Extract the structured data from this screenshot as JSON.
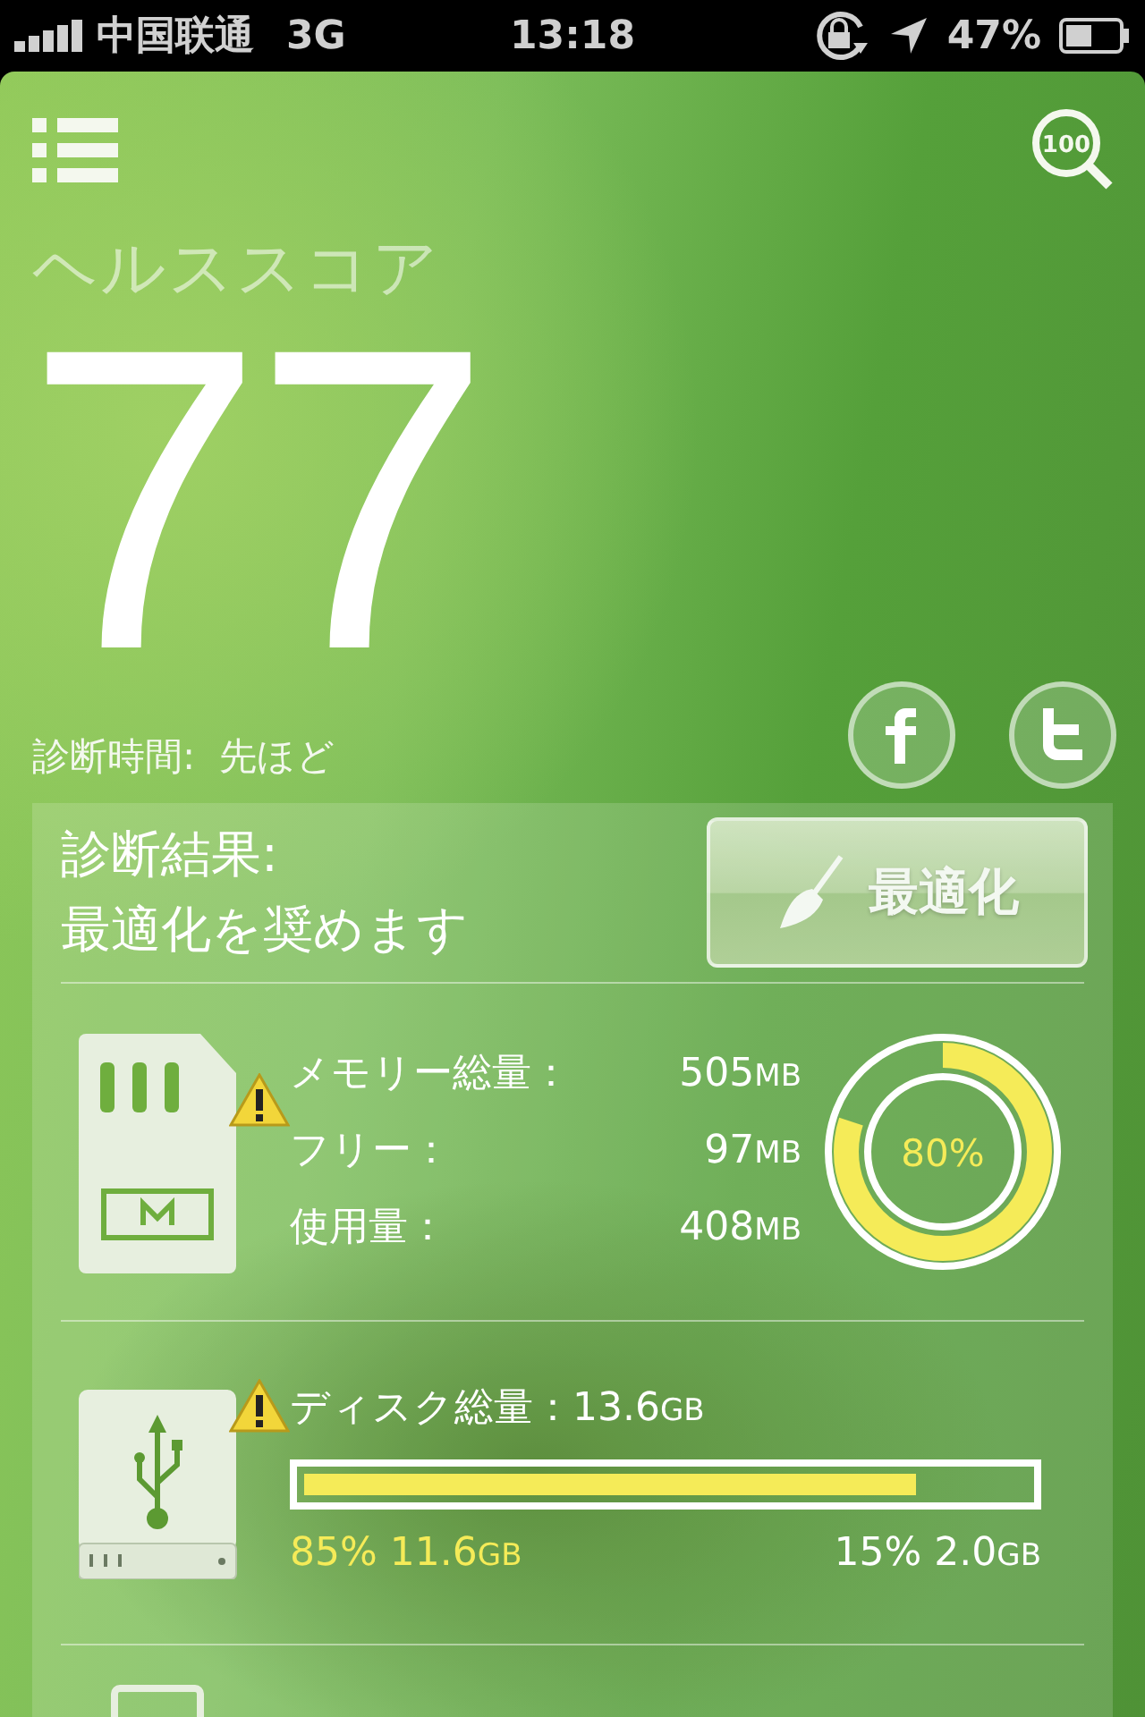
{
  "status_bar": {
    "carrier": "中国联通",
    "network": "3G",
    "time": "13:18",
    "battery": "47%"
  },
  "score_search": {
    "label": "100"
  },
  "health": {
    "title": "ヘルススコア",
    "score": "77",
    "diagnosis_time": "診断時間:  先ほど"
  },
  "result": {
    "lines": [
      "診断結果:",
      "最適化を奨めます"
    ],
    "button": "最適化"
  },
  "memory": {
    "warning": true,
    "rows": [
      {
        "label": "メモリー総量：",
        "value": "505",
        "unit": "MB"
      },
      {
        "label": "フリー：",
        "value": "97",
        "unit": "MB"
      },
      {
        "label": "使用量：",
        "value": "408",
        "unit": "MB"
      }
    ],
    "level": 0.8,
    "reading": "80%"
  },
  "disk": {
    "warning": true,
    "label": "ディスク総量：",
    "total": "13.6",
    "total_unit": "GB",
    "level": 0.85,
    "used": {
      "percent": "85%",
      "value": "11.6",
      "unit": "GB"
    },
    "free": {
      "percent": "15%",
      "value": "2.0",
      "unit": "GB"
    }
  }
}
